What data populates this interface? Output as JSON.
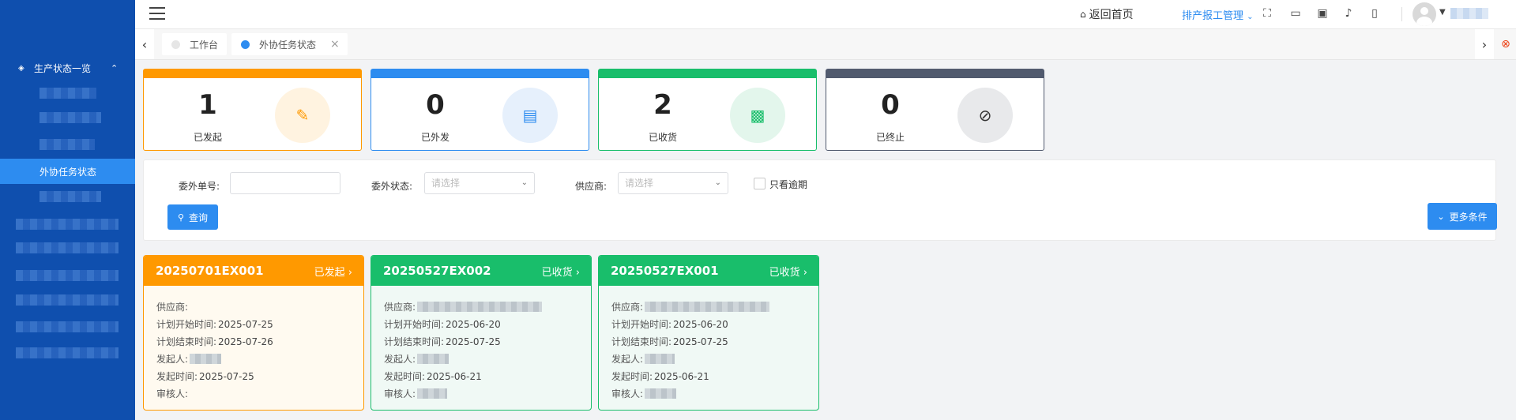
{
  "sidebar": {
    "group_label": "生产状态一览",
    "active_item": "外协任务状态"
  },
  "topbar": {
    "home": "返回首页",
    "menu_link": "排产报工管理"
  },
  "tabs": [
    {
      "label": "工作台"
    },
    {
      "label": "外协任务状态"
    }
  ],
  "stats": [
    {
      "value": "1",
      "label": "已发起",
      "color": "#ff9900"
    },
    {
      "value": "0",
      "label": "已外发",
      "color": "#2d8cf0"
    },
    {
      "value": "2",
      "label": "已收货",
      "color": "#19be6b"
    },
    {
      "value": "0",
      "label": "已终止",
      "color": "#515a6e"
    }
  ],
  "filter": {
    "order_no_label": "委外单号:",
    "status_label": "委外状态:",
    "status_placeholder": "请选择",
    "supplier_label": "供应商:",
    "supplier_placeholder": "请选择",
    "overdue_label": "只看逾期",
    "query_button": "查询",
    "more_button": "更多条件"
  },
  "cards": [
    {
      "code": "20250701EX001",
      "status": "已发起",
      "color": "#ff9900",
      "bg": "#fffaf0",
      "supplier_label": "供应商:",
      "start_label": "计划开始时间:",
      "start": "2025-07-25",
      "end_label": "计划结束时间:",
      "end": "2025-07-26",
      "initiator_label": "发起人:",
      "sent_label": "发起时间:",
      "sent": "2025-07-25",
      "reviewer_label": "审核人:"
    },
    {
      "code": "20250527EX002",
      "status": "已收货",
      "color": "#19be6b",
      "bg": "#f0f9f5",
      "supplier_label": "供应商:",
      "start_label": "计划开始时间:",
      "start": "2025-06-20",
      "end_label": "计划结束时间:",
      "end": "2025-07-25",
      "initiator_label": "发起人:",
      "sent_label": "发起时间:",
      "sent": "2025-06-21",
      "reviewer_label": "审核人:"
    },
    {
      "code": "20250527EX001",
      "status": "已收货",
      "color": "#19be6b",
      "bg": "#f0f9f5",
      "supplier_label": "供应商:",
      "start_label": "计划开始时间:",
      "start": "2025-06-20",
      "end_label": "计划结束时间:",
      "end": "2025-07-25",
      "initiator_label": "发起人:",
      "sent_label": "发起时间:",
      "sent": "2025-06-21",
      "reviewer_label": "审核人:"
    }
  ]
}
